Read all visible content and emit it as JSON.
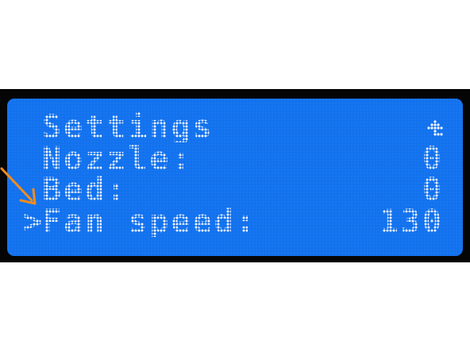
{
  "display": {
    "title": "Settings",
    "back_icon": "up-arrow-icon",
    "cursor": ">",
    "items": [
      {
        "label": "Nozzle:",
        "value": "0"
      },
      {
        "label": "Bed:",
        "value": "0"
      },
      {
        "label": "Fan speed:",
        "value": "130"
      }
    ],
    "selected_index": 2
  },
  "colors": {
    "lcd_background": "#1272ee",
    "lcd_text": "#f4f6ff",
    "bezel": "#050505",
    "annotation_arrow": "#f28c1e"
  },
  "annotation": {
    "icon": "arrow-pointer-icon"
  }
}
